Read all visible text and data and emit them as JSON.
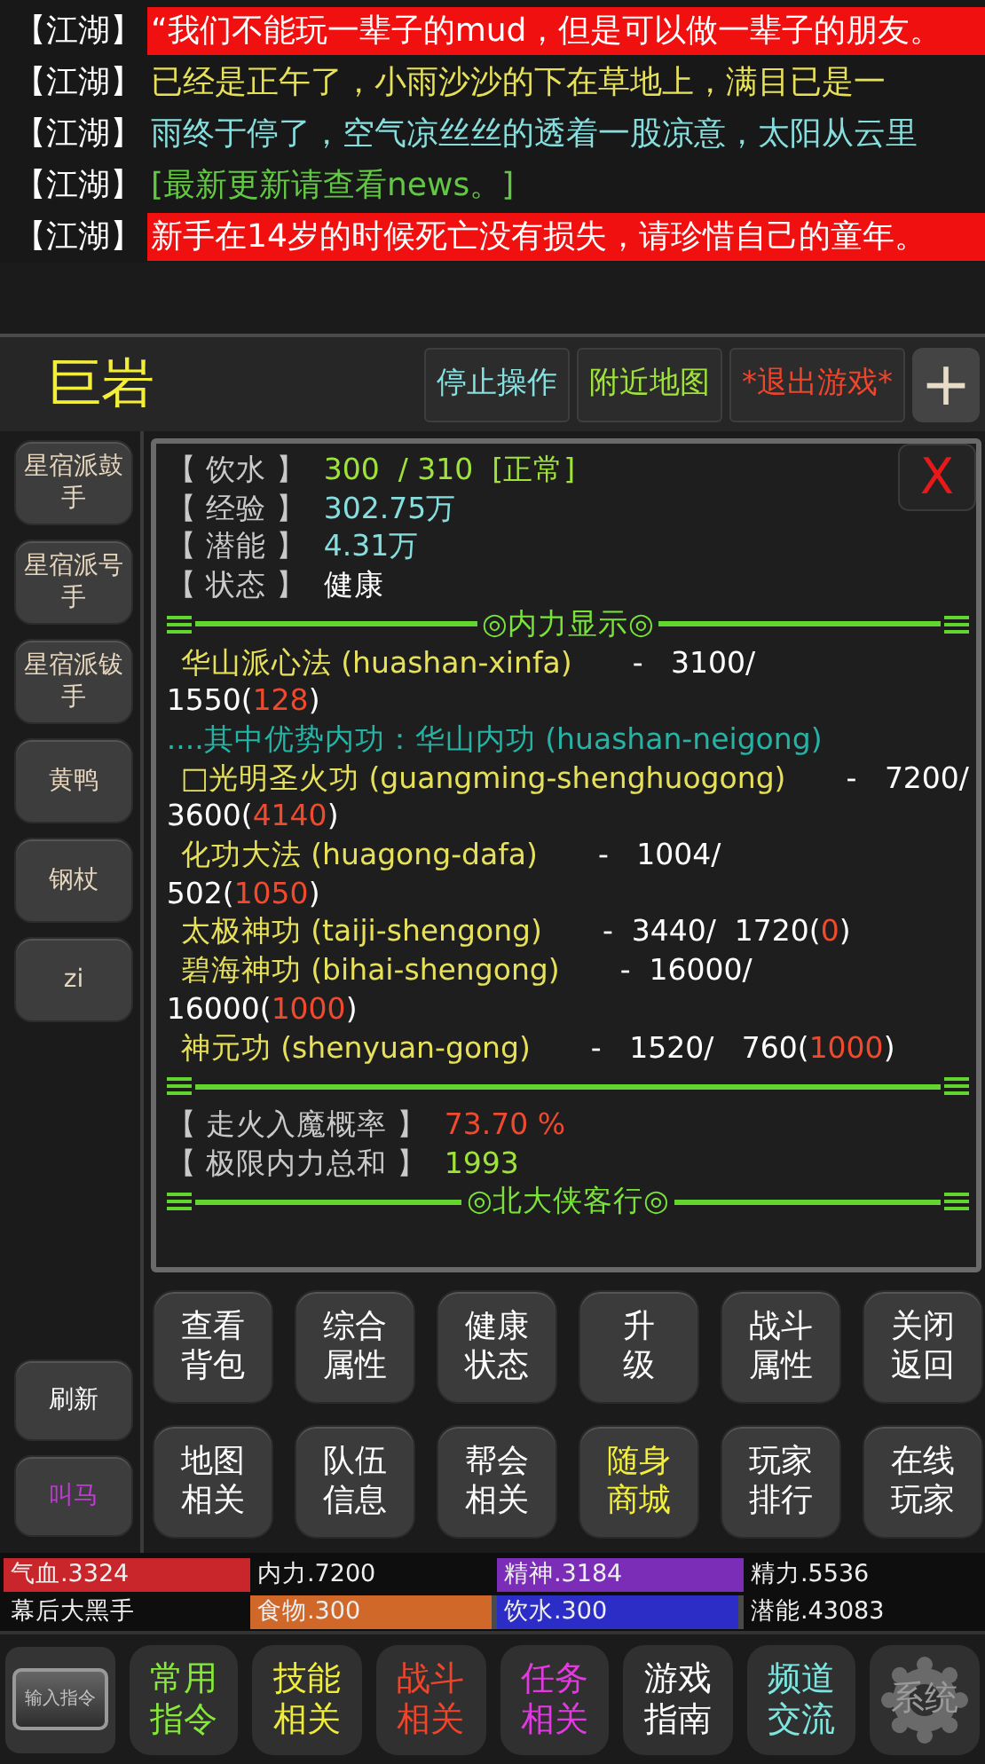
{
  "chat": [
    {
      "channel": "【江湖】",
      "text": "“我们不能玩一辈子的mud，但是可以做一辈子的朋友。",
      "color": "#ffffff",
      "highlight": true
    },
    {
      "channel": "【江湖】",
      "text": "已经是正午了，小雨沙沙的下在草地上，满目已是一",
      "color": "#e6e05a",
      "highlight": false
    },
    {
      "channel": "【江湖】",
      "text": "雨终于停了，空气凉丝丝的透着一股凉意，太阳从云里",
      "color": "#86dede",
      "highlight": false
    },
    {
      "channel": "【江湖】",
      "text": "[最新更新请查看news。]",
      "color": "#62c843",
      "highlight": false
    },
    {
      "channel": "【江湖】",
      "text": "新手在14岁的时候死亡没有损失，请珍惜自己的童年。",
      "color": "#ffffff",
      "highlight": true
    }
  ],
  "header": {
    "name": "巨岩",
    "buttons": [
      {
        "label": "停止操作",
        "color": "#86e0e0"
      },
      {
        "label": "附近地图",
        "color": "#9ee23a"
      },
      {
        "label": "*退出游戏*",
        "color": "#f0452a"
      }
    ],
    "add": "+"
  },
  "sidebar": {
    "top": [
      {
        "label": "星宿派鼓手",
        "color": "#e6d6bd"
      },
      {
        "label": "星宿派号手",
        "color": "#e6d6bd"
      },
      {
        "label": "星宿派钹手",
        "color": "#e6d6bd"
      },
      {
        "label": "黄鸭",
        "color": "#e6d6bd"
      },
      {
        "label": "钢杖",
        "color": "#e6d6bd"
      },
      {
        "label": "zi",
        "color": "#e6d6bd"
      }
    ],
    "bottom": [
      {
        "label": "刷新",
        "color": "#ffffff"
      },
      {
        "label": "叫马",
        "color": "#c23ad6"
      }
    ]
  },
  "panel": {
    "close": "X",
    "rows": [
      {
        "kind": "stat",
        "label": "【 饮水 】",
        "value": "300  / 310  [正常]",
        "color": "#9ee23a"
      },
      {
        "kind": "stat",
        "label": "【 经验 】",
        "value": "302.75万",
        "color": "#86dede"
      },
      {
        "kind": "stat",
        "label": "【 潜能 】",
        "value": "4.31万",
        "color": "#86dede"
      },
      {
        "kind": "stat",
        "label": "【 状态 】",
        "value": "健康",
        "color": "#ffffff"
      },
      {
        "kind": "divider",
        "title": "◎内力显示◎"
      },
      {
        "kind": "skill",
        "name": "华山派心法 (huashan-xinfa)",
        "segments": [
          {
            "text": "-   3100/",
            "color": "#ffffff"
          }
        ]
      },
      {
        "kind": "cont",
        "segments": [
          {
            "text": "1550(",
            "color": "#ffffff"
          },
          {
            "text": "128",
            "color": "#ef4a2e"
          },
          {
            "text": ")",
            "color": "#ffffff"
          }
        ]
      },
      {
        "kind": "note",
        "text": "....其中优势内功：华山内功 (huashan-neigong)",
        "color": "#25b3a6"
      },
      {
        "kind": "skill",
        "name": "□光明圣火功 (guangming-shenghuogong)",
        "segments": [
          {
            "text": "-   7200/",
            "color": "#ffffff"
          }
        ]
      },
      {
        "kind": "cont",
        "segments": [
          {
            "text": "3600(",
            "color": "#ffffff"
          },
          {
            "text": "4140",
            "color": "#ef4a2e"
          },
          {
            "text": ")",
            "color": "#ffffff"
          }
        ]
      },
      {
        "kind": "skill",
        "name": "化功大法 (huagong-dafa)",
        "segments": [
          {
            "text": "-   1004/",
            "color": "#ffffff"
          }
        ]
      },
      {
        "kind": "cont",
        "segments": [
          {
            "text": "502(",
            "color": "#ffffff"
          },
          {
            "text": "1050",
            "color": "#ef4a2e"
          },
          {
            "text": ")",
            "color": "#ffffff"
          }
        ]
      },
      {
        "kind": "skill",
        "name": "太极神功 (taiji-shengong)",
        "segments": [
          {
            "text": "-  3440/  1720(",
            "color": "#ffffff"
          },
          {
            "text": "0",
            "color": "#ef4a2e"
          },
          {
            "text": ")",
            "color": "#ffffff"
          }
        ]
      },
      {
        "kind": "skill",
        "name": "碧海神功 (bihai-shengong)",
        "segments": [
          {
            "text": "-  16000/",
            "color": "#ffffff"
          }
        ]
      },
      {
        "kind": "cont",
        "segments": [
          {
            "text": "16000(",
            "color": "#ffffff"
          },
          {
            "text": "1000",
            "color": "#ef4a2e"
          },
          {
            "text": ")",
            "color": "#ffffff"
          }
        ]
      },
      {
        "kind": "skill",
        "name": "神元功 (shenyuan-gong)",
        "segments": [
          {
            "text": "-   1520/   760(",
            "color": "#ffffff"
          },
          {
            "text": "1000",
            "color": "#ef4a2e"
          },
          {
            "text": ")",
            "color": "#ffffff"
          }
        ]
      },
      {
        "kind": "divider"
      },
      {
        "kind": "stat",
        "label": "【 走火入魔概率 】",
        "value": "73.70 %",
        "color": "#ef4a2e"
      },
      {
        "kind": "stat",
        "label": "【 极限内力总和 】",
        "value": "1993",
        "color": "#9ee23a"
      },
      {
        "kind": "divider",
        "title": "◎北大侠客行◎"
      }
    ]
  },
  "actions": [
    {
      "lines": [
        "查看",
        "背包"
      ],
      "color": "#ffffff"
    },
    {
      "lines": [
        "综合",
        "属性"
      ],
      "color": "#ffffff"
    },
    {
      "lines": [
        "健康",
        "状态"
      ],
      "color": "#ffffff"
    },
    {
      "lines": [
        "升",
        "级"
      ],
      "color": "#ffffff"
    },
    {
      "lines": [
        "战斗",
        "属性"
      ],
      "color": "#ffffff"
    },
    {
      "lines": [
        "关闭",
        "返回"
      ],
      "color": "#ffffff"
    },
    {
      "lines": [
        "地图",
        "相关"
      ],
      "color": "#ffffff"
    },
    {
      "lines": [
        "队伍",
        "信息"
      ],
      "color": "#ffffff"
    },
    {
      "lines": [
        "帮会",
        "相关"
      ],
      "color": "#ffffff"
    },
    {
      "lines": [
        "随身",
        "商城"
      ],
      "color": "#f2ee3a"
    },
    {
      "lines": [
        "玩家",
        "排行"
      ],
      "color": "#ffffff"
    },
    {
      "lines": [
        "在线",
        "玩家"
      ],
      "color": "#ffffff"
    }
  ],
  "stats": [
    {
      "text": "气血.3324",
      "color": "#c8262a",
      "level": 1
    },
    {
      "text": "内力.7200"
    },
    {
      "text": "精神.3184",
      "color": "#7b2db8",
      "level": 1
    },
    {
      "text": "精力.5536"
    },
    {
      "text": "幕后大黑手"
    },
    {
      "text": "食物.300",
      "color": "#d0682a",
      "level": 0.98
    },
    {
      "text": "饮水.300",
      "color": "#2c2dc6",
      "level": 0.98
    },
    {
      "text": "潜能.43083"
    }
  ],
  "bottom_bar": {
    "input": "输入指令",
    "buttons": [
      {
        "kind": "text",
        "lines": [
          "常用",
          "指令"
        ],
        "color": "#86e83a"
      },
      {
        "kind": "text",
        "lines": [
          "技能",
          "相关"
        ],
        "color": "#f0ec3a"
      },
      {
        "kind": "text",
        "lines": [
          "战斗",
          "相关"
        ],
        "color": "#f0452a"
      },
      {
        "kind": "text",
        "lines": [
          "任务",
          "相关"
        ],
        "color": "#e23ae0"
      },
      {
        "kind": "text",
        "lines": [
          "游戏",
          "指南"
        ],
        "color": "#ffffff"
      },
      {
        "kind": "text",
        "lines": [
          "频道",
          "交流"
        ],
        "color": "#7ee6e0"
      },
      {
        "kind": "gear",
        "lines": [
          "系统"
        ],
        "color": "#9a9a9a"
      }
    ]
  }
}
